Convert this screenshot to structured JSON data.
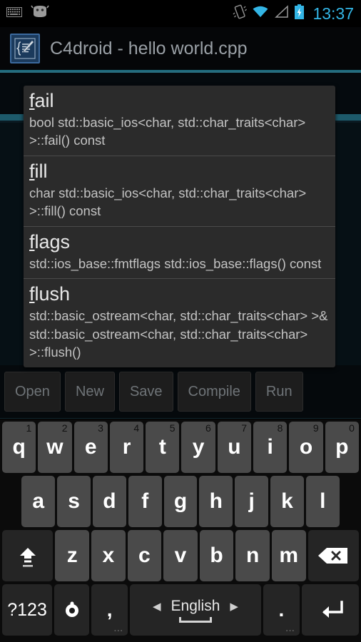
{
  "status_bar": {
    "icons_left": [
      "keyboard-icon",
      "android-robot-icon"
    ],
    "icons_right": [
      "vibrate-icon",
      "wifi-icon",
      "cell-signal-icon",
      "battery-charging-icon"
    ],
    "time": "13:37",
    "accent_color": "#33b5e5"
  },
  "title_bar": {
    "app_icon": "c4droid-icon",
    "title": "C4droid - hello world.cpp",
    "rule_color": "#1f6b7d"
  },
  "editor": {
    "background": "#050a0e",
    "cursor_line_color": "#1d5a6b"
  },
  "autocomplete": {
    "items": [
      {
        "prefix": "f",
        "rest": "ail",
        "signature": "bool std::basic_ios<char, std::char_traits<char> >::fail() const"
      },
      {
        "prefix": "f",
        "rest": "ill",
        "signature": "char std::basic_ios<char, std::char_traits<char> >::fill() const"
      },
      {
        "prefix": "f",
        "rest": "lags",
        "signature": "std::ios_base::fmtflags std::ios_base::flags() const"
      },
      {
        "prefix": "f",
        "rest": "lush",
        "signature": "std::basic_ostream<char, std::char_traits<char> >& std::basic_ostream<char, std::char_traits<char> >::flush()"
      }
    ]
  },
  "action_bar": {
    "buttons": [
      {
        "label": "Open"
      },
      {
        "label": "New"
      },
      {
        "label": "Save"
      },
      {
        "label": "Compile"
      },
      {
        "label": "Run"
      }
    ]
  },
  "keyboard": {
    "row1": [
      {
        "label": "q",
        "alt": "1"
      },
      {
        "label": "w",
        "alt": "2"
      },
      {
        "label": "e",
        "alt": "3"
      },
      {
        "label": "r",
        "alt": "4"
      },
      {
        "label": "t",
        "alt": "5"
      },
      {
        "label": "y",
        "alt": "6"
      },
      {
        "label": "u",
        "alt": "7"
      },
      {
        "label": "i",
        "alt": "8"
      },
      {
        "label": "o",
        "alt": "9"
      },
      {
        "label": "p",
        "alt": "0"
      }
    ],
    "row2": [
      {
        "label": "a"
      },
      {
        "label": "s"
      },
      {
        "label": "d"
      },
      {
        "label": "f"
      },
      {
        "label": "g"
      },
      {
        "label": "h"
      },
      {
        "label": "j"
      },
      {
        "label": "k"
      },
      {
        "label": "l"
      }
    ],
    "row3": [
      {
        "label": "z"
      },
      {
        "label": "x"
      },
      {
        "label": "c"
      },
      {
        "label": "v"
      },
      {
        "label": "b"
      },
      {
        "label": "n"
      },
      {
        "label": "m"
      }
    ],
    "shift_key": "shift-icon",
    "backspace_key": "backspace-icon",
    "symbols_key": "?123",
    "mic_key": "voice-input-icon",
    "comma_key": ",",
    "comma_more": "...",
    "space_language": "English",
    "space_left_arrow": "◀",
    "space_right_arrow": "▶",
    "period_key": ".",
    "period_more": "...",
    "enter_key": "enter-icon"
  }
}
